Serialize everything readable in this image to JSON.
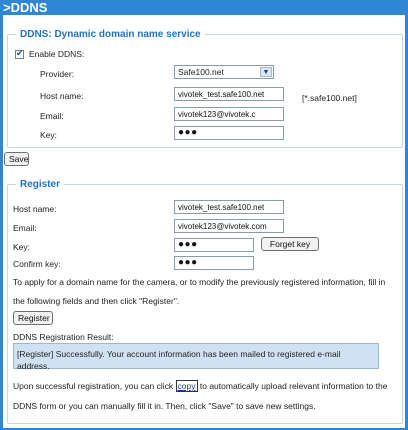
{
  "header": {
    "title": ">DDNS"
  },
  "ddns_section": {
    "legend": "DDNS: Dynamic domain name service",
    "enable_label": "Enable DDNS:",
    "enable_checked": true,
    "provider_label": "Provider:",
    "provider_value": "Safe100.net",
    "hostname_label": "Host name:",
    "hostname_value": "vivotek_test.safe100.net",
    "hostname_hint": "[*.safe100.net]",
    "email_label": "Email:",
    "email_value": "vivotek123@vivotek.c",
    "key_label": "Key:",
    "key_value": "●●●"
  },
  "save_label": "Save",
  "register_section": {
    "legend": "Register",
    "hostname_label": "Host name:",
    "hostname_value": "vivotek_test.safe100.net",
    "email_label": "Email:",
    "email_value": "vivotek123@vivotek.com",
    "key_label": "Key:",
    "key_value": "●●●",
    "forget_key_label": "Forget key",
    "confirm_key_label": "Confirm key:",
    "confirm_key_value": "●●●",
    "instruction_line1": "To apply for a domain name for the camera, or to modify the previously registered information, fill in",
    "instruction_line2": "the following fields and then click \"Register\".",
    "register_button_label": "Register",
    "result_label": "DDNS Registration Result:",
    "result_text": "[Register] Successfully. Your account information has been mailed to registered e-mail address.",
    "footer_line1_pre": "Upon successful registration, you can click",
    "copy_link": "copy",
    "footer_line1_post": "to automatically upload relevant information to the",
    "footer_line2": "DDNS form or you can manually fill it in. Then, click \"Save\" to save new settings."
  },
  "colors": {
    "accent": "#2f86d4",
    "legend": "#1f73c2",
    "result_bg": "#cfe2f3"
  }
}
